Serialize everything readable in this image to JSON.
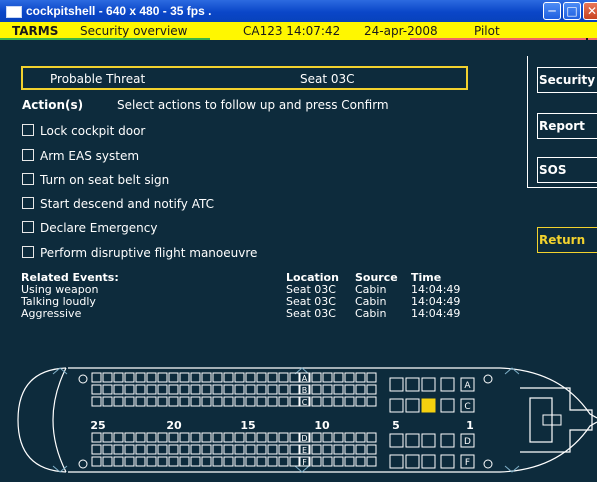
{
  "window": {
    "title": "cockpitshell - 640 x 480 - 35  fps ."
  },
  "statusbar": {
    "app": "TARMS",
    "screen": "Security overview",
    "flight_time": "CA123 14:07:42",
    "date": "24-apr-2008",
    "role": "Pilot"
  },
  "threat": {
    "label": "Probable Threat",
    "location": "Seat 03C"
  },
  "actions": {
    "header": "Action(s)",
    "instruction": "Select actions to follow up and press Confirm",
    "options": [
      "Lock cockpit door",
      "Arm EAS system",
      "Turn on seat belt sign",
      "Start descend and notify ATC",
      "Declare Emergency",
      "Perform disruptive flight manoeuvre"
    ]
  },
  "events": {
    "headers": {
      "event": "Related Events:",
      "location": "Location",
      "source": "Source",
      "time": "Time"
    },
    "rows": [
      {
        "event": "Using weapon",
        "location": "Seat 03C",
        "source": "Cabin",
        "time": "14:04:49"
      },
      {
        "event": "Talking loudly",
        "location": "Seat 03C",
        "source": "Cabin",
        "time": "14:04:49"
      },
      {
        "event": "Aggressive",
        "location": "Seat 03C",
        "source": "Cabin",
        "time": "14:04:49"
      }
    ]
  },
  "sidebar": {
    "security": "Security",
    "report": "Report",
    "sos": "SOS",
    "return": "Return"
  },
  "seatmap": {
    "row_numbers": [
      "25",
      "20",
      "15",
      "10",
      "5",
      "1"
    ],
    "seat_letters": [
      "A",
      "B",
      "C",
      "D",
      "E",
      "F"
    ],
    "selected_seat": "03C",
    "highlight_color": "#f5d10f"
  },
  "colors": {
    "background": "#0d2b3c",
    "status_bar": "#fff700",
    "accent_yellow": "#f2d22e",
    "status_green": "#3bb34a",
    "status_red": "#ef6767"
  }
}
